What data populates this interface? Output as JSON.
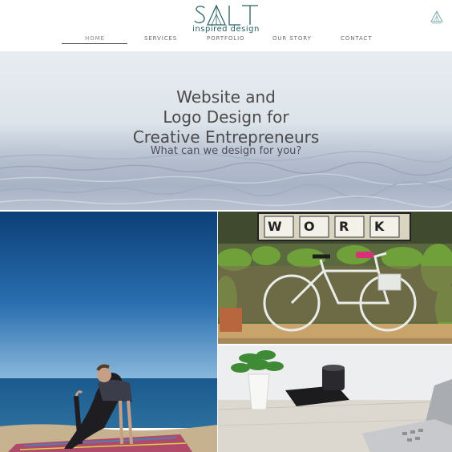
{
  "brand": {
    "logo_text": "SALT",
    "tagline": "inspired design",
    "logo_color": "#2b5f62"
  },
  "nav": {
    "items": [
      {
        "label": "HOME",
        "active": true
      },
      {
        "label": "SERVICES",
        "active": false
      },
      {
        "label": "PORTFOLIO",
        "active": false
      },
      {
        "label": "OUR STORY",
        "active": false
      },
      {
        "label": "CONTACT",
        "active": false
      }
    ]
  },
  "corner_badge": {
    "icon": "salt-mini-logo-icon"
  },
  "hero": {
    "title_lines": [
      "Website and",
      "Logo Design for",
      "Creative Entrepreneurs"
    ],
    "subtitle": "What can we design for you?"
  },
  "gallery": {
    "bike_sign_letters": [
      "W",
      "O",
      "R",
      "K"
    ]
  }
}
